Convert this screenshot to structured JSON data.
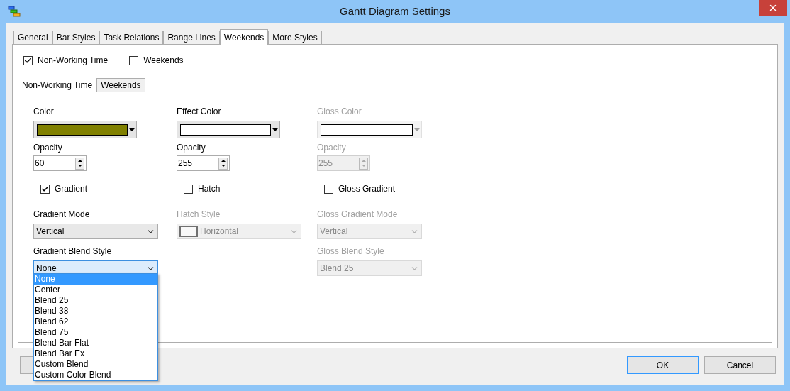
{
  "window": {
    "title": "Gantt Diagram Settings"
  },
  "tabs": [
    {
      "label": "General",
      "selected": false
    },
    {
      "label": "Bar Styles",
      "selected": false
    },
    {
      "label": "Task Relations",
      "selected": false
    },
    {
      "label": "Range Lines",
      "selected": false
    },
    {
      "label": "Weekends",
      "selected": true
    },
    {
      "label": "More Styles",
      "selected": false
    }
  ],
  "options": [
    {
      "label": "Non-Working Time",
      "checked": true
    },
    {
      "label": "Weekends",
      "checked": false
    }
  ],
  "subtabs": [
    {
      "label": "Non-Working Time",
      "selected": true
    },
    {
      "label": "Weekends",
      "selected": false
    }
  ],
  "columns": [
    {
      "color_label": "Color",
      "color": "#808000",
      "color_disabled": false,
      "opacity_label": "Opacity",
      "opacity": "60",
      "opacity_disabled": false,
      "checkbox": {
        "label": "Gradient",
        "checked": true
      },
      "selects": [
        {
          "label": "Gradient Mode",
          "value": "Vertical",
          "kind": "plain",
          "disabled": false,
          "expanded": false
        },
        {
          "label": "Gradient Blend Style",
          "value": "None",
          "kind": "plain",
          "disabled": false,
          "expanded": true,
          "options": [
            {
              "label": "None",
              "selected": true
            },
            {
              "label": "Center",
              "selected": false
            },
            {
              "label": "Blend 25",
              "selected": false
            },
            {
              "label": "Blend 38",
              "selected": false
            },
            {
              "label": "Blend 62",
              "selected": false
            },
            {
              "label": "Blend 75",
              "selected": false
            },
            {
              "label": "Blend Bar Flat",
              "selected": false
            },
            {
              "label": "Blend Bar Ex",
              "selected": false
            },
            {
              "label": "Custom Blend",
              "selected": false
            },
            {
              "label": "Custom Color Blend",
              "selected": false
            }
          ]
        }
      ]
    },
    {
      "color_label": "Effect Color",
      "color": "#ffffff",
      "color_disabled": false,
      "opacity_label": "Opacity",
      "opacity": "255",
      "opacity_disabled": false,
      "checkbox": {
        "label": "Hatch",
        "checked": false
      },
      "selects": [
        {
          "label": "Hatch Style",
          "value": "Horizontal",
          "kind": "pattern",
          "disabled": true,
          "expanded": false
        }
      ]
    },
    {
      "color_label": "Gloss Color",
      "color": "#ffffff",
      "color_disabled": true,
      "opacity_label": "Opacity",
      "opacity": "255",
      "opacity_disabled": true,
      "checkbox": {
        "label": "Gloss Gradient",
        "checked": false
      },
      "selects": [
        {
          "label": "Gloss Gradient Mode",
          "value": "Vertical",
          "kind": "plain",
          "disabled": true,
          "expanded": false
        },
        {
          "label": "Gloss Blend Style",
          "value": "Blend 25",
          "kind": "plain",
          "disabled": true,
          "expanded": false
        }
      ]
    }
  ],
  "buttons": [
    {
      "label": "OK",
      "kind": "default"
    },
    {
      "label": "Cancel",
      "kind": "normal"
    }
  ]
}
